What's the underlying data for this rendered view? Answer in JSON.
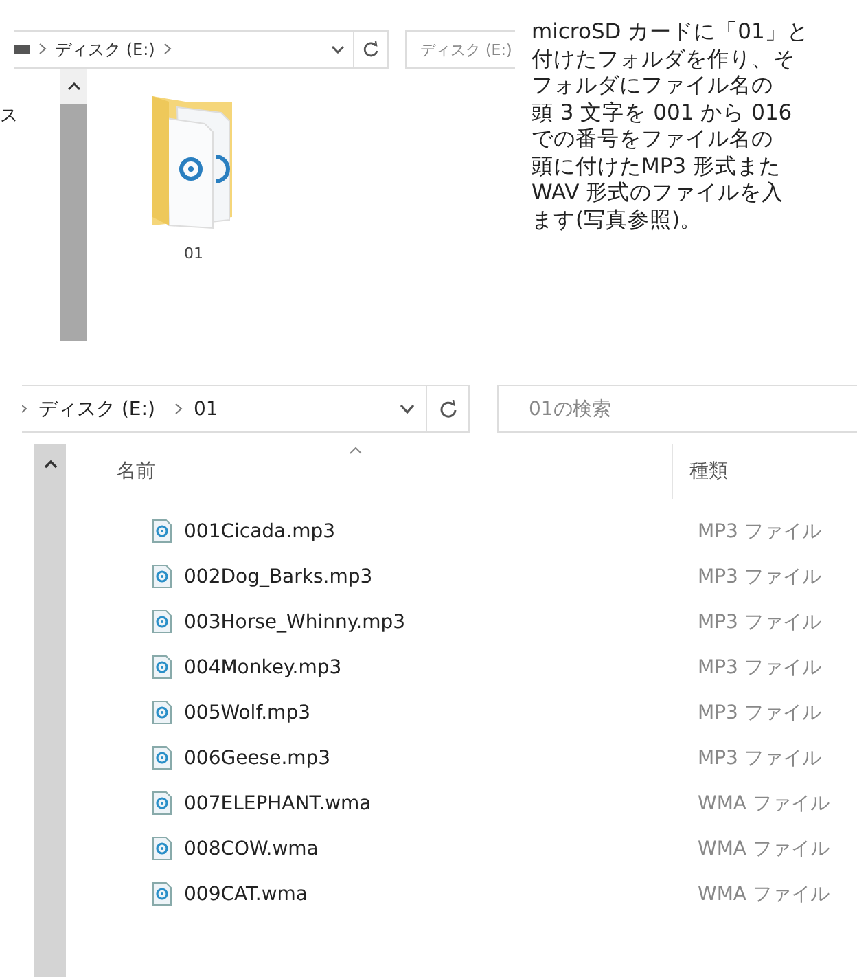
{
  "top_window": {
    "breadcrumb": [
      "ディスク (E:)"
    ],
    "search_placeholder": "ディスク (E:)",
    "sidebar_text": "ス",
    "folders": [
      {
        "name": "01"
      }
    ]
  },
  "note": {
    "lines": [
      "microSD カードに「01」と",
      "付けたフォルダを作り、そ",
      "フォルダにファイル名の",
      "頭 3 文字を 001 から 016",
      "での番号をファイル名の",
      "頭に付けたMP3 形式また",
      "WAV 形式のファイルを入",
      "ます(写真参照)。"
    ]
  },
  "bottom_window": {
    "breadcrumb": [
      "ディスク (E:)",
      "01"
    ],
    "search_placeholder": "01の検索",
    "columns": [
      "名前",
      "種類"
    ],
    "files": [
      {
        "name": "001Cicada.mp3",
        "type": "MP3 ファイル"
      },
      {
        "name": "002Dog_Barks.mp3",
        "type": "MP3 ファイル"
      },
      {
        "name": "003Horse_Whinny.mp3",
        "type": "MP3 ファイル"
      },
      {
        "name": "004Monkey.mp3",
        "type": "MP3 ファイル"
      },
      {
        "name": "005Wolf.mp3",
        "type": "MP3 ファイル"
      },
      {
        "name": "006Geese.mp3",
        "type": "MP3 ファイル"
      },
      {
        "name": "007ELEPHANT.wma",
        "type": "WMA ファイル"
      },
      {
        "name": "008COW.wma",
        "type": "WMA ファイル"
      },
      {
        "name": "009CAT.wma",
        "type": "WMA ファイル"
      }
    ]
  }
}
